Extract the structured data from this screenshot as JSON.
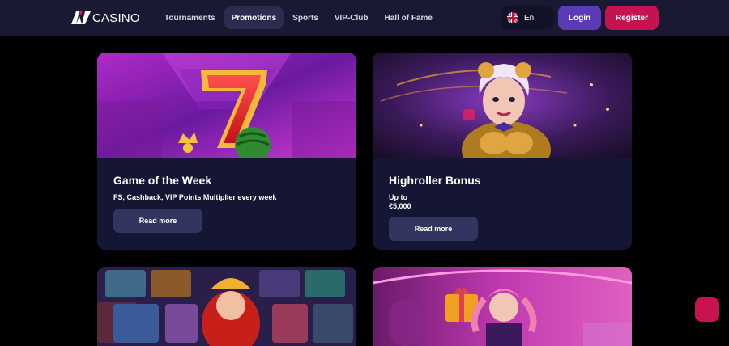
{
  "header": {
    "logo_text": "CASINO",
    "nav": [
      {
        "label": "Tournaments",
        "active": false
      },
      {
        "label": "Promotions",
        "active": true
      },
      {
        "label": "Sports",
        "active": false
      },
      {
        "label": "VIP-Club",
        "active": false
      },
      {
        "label": "Hall of Fame",
        "active": false
      }
    ],
    "language": "En",
    "login_label": "Login",
    "register_label": "Register"
  },
  "promotions": [
    {
      "title": "Game of the Week",
      "desc_line1": "FS, Cashback, VIP Points Multiplier every week",
      "desc_line2": "",
      "button": "Read more"
    },
    {
      "title": "Highroller Bonus",
      "desc_line1": "Up to",
      "desc_line2": "€5,000",
      "button": "Read more"
    }
  ],
  "colors": {
    "header_bg": "#1a1934",
    "page_bg": "#000000",
    "card_bg": "#151633",
    "login_bg": "#5c3ab7",
    "register_bg": "#c4134e",
    "button_bg": "#333560"
  },
  "icons": {
    "flag": "uk-flag-icon",
    "chat": "chat-icon"
  }
}
